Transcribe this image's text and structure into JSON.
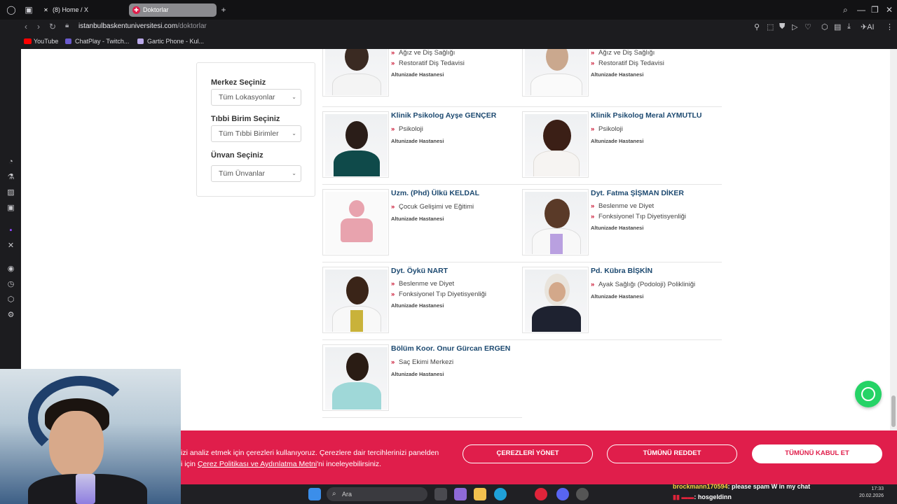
{
  "browser": {
    "tabs": [
      {
        "label": "(8) Home / X",
        "active": false
      },
      {
        "label": "Doktorlar",
        "active": true
      }
    ],
    "url_host": "istanbulbaskentuniversitesi.com",
    "url_path": "/doktorlar",
    "bookmarks": [
      "YouTube",
      "ChatPlay - Twitch...",
      "Gartic Phone - Kul..."
    ],
    "ai_label": "AI"
  },
  "filters": {
    "center_label": "Merkez Seçiniz",
    "center_value": "Tüm Lokasyonlar",
    "unit_label": "Tıbbi Birim Seçiniz",
    "unit_value": "Tüm Tıbbi Birimler",
    "title_label": "Ünvan Seçiniz",
    "title_value": "Tüm Ünvanlar"
  },
  "doctors": [
    {
      "name": "",
      "depts": [
        "Ağız ve Diş Sağlığı",
        "Restoratif Diş Tedavisi"
      ],
      "hospital": "Altunizade Hastanesi"
    },
    {
      "name": "",
      "depts": [
        "Ağız ve Diş Sağlığı",
        "Restoratif Diş Tedavisi"
      ],
      "hospital": "Altunizade Hastanesi"
    },
    {
      "name": "Klinik Psikolog Ayşe GENÇER",
      "depts": [
        "Psikoloji"
      ],
      "hospital": "Altunizade Hastanesi"
    },
    {
      "name": "Klinik Psikolog Meral AYMUTLU",
      "depts": [
        "Psikoloji"
      ],
      "hospital": "Altunizade Hastanesi"
    },
    {
      "name": "Uzm. (Phd) Ülkü KELDAL",
      "depts": [
        "Çocuk Gelişimi ve Eğitimi"
      ],
      "hospital": "Altunizade Hastanesi"
    },
    {
      "name": "Dyt. Fatma ŞİŞMAN DİKER",
      "depts": [
        "Beslenme ve Diyet",
        "Fonksiyonel Tıp Diyetisyenliği"
      ],
      "hospital": "Altunizade Hastanesi"
    },
    {
      "name": "Dyt. Öykü NART",
      "depts": [
        "Beslenme ve Diyet",
        "Fonksiyonel Tıp Diyetisyenliği"
      ],
      "hospital": "Altunizade Hastanesi"
    },
    {
      "name": "Pd. Kübra BİŞKİN",
      "depts": [
        "Ayak Sağlığı (Podoloji) Polikliniği"
      ],
      "hospital": "Altunizade Hastanesi"
    },
    {
      "name": "Bölüm Koor. Onur Gürcan ERGEN",
      "depts": [
        "Saç Ekimi Merkezi"
      ],
      "hospital": "Altunizade Hastanesi"
    }
  ],
  "cookie": {
    "line1": "izi analiz etmek için çerezleri kullanıyoruz. Çerezlere dair tercihlerinizi panelden",
    "line2_prefix": "i için ",
    "policy_link": "Çerez Politikası ve Aydınlatma Metni",
    "line2_suffix": "'ni inceleyebilirsiniz.",
    "manage": "ÇEREZLERİ YÖNET",
    "reject": "TÜMÜNÜ REDDET",
    "accept": "TÜMÜNÜ KABUL ET"
  },
  "taskbar": {
    "search_placeholder": "Ara",
    "time": "17:33",
    "date": "20.02.2026"
  },
  "chat": [
    {
      "user": "brockmann170594",
      "message": ": please spam W in my chat"
    },
    {
      "user": "",
      "message": ": hosgeldinn"
    }
  ],
  "colors": {
    "brand_red": "#e01e4b",
    "name_blue": "#1c4970",
    "chevron_red": "#c8102e",
    "whatsapp": "#25d366"
  }
}
